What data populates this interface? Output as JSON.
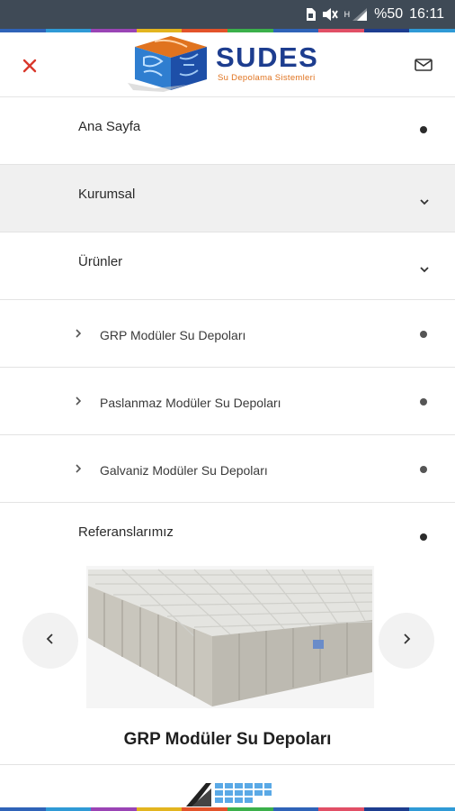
{
  "status_bar": {
    "battery": "%50",
    "time": "16:11",
    "network": "H",
    "icons": [
      "sim-card-icon",
      "mute-icon",
      "signal-icon"
    ]
  },
  "header": {
    "logo_title": "SUDES",
    "logo_subtitle": "Su Depolama Sistemleri",
    "close_icon": "close-icon",
    "mail_icon": "mail-icon"
  },
  "colors": {
    "accent_red": "#d9382c",
    "brand_blue": "#1d3d8f",
    "brand_orange": "#e0731f",
    "status_bar": "#3f4a56",
    "strip": [
      "#2f63b8",
      "#2f9ad6",
      "#9a44b5",
      "#e3b51f",
      "#e3532a",
      "#3bb04b",
      "#2f63b8",
      "#e14f66",
      "#1d3d8f",
      "#2f9ad6"
    ]
  },
  "menu": {
    "items": [
      {
        "label": "Ana Sayfa",
        "indicator": "dot",
        "active": false
      },
      {
        "label": "Kurumsal",
        "indicator": "chevron-down",
        "active": true
      },
      {
        "label": "Ürünler",
        "indicator": "chevron-down",
        "active": false
      },
      {
        "label": "GRP Modüler Su Depoları",
        "indicator": "dot",
        "sub": true
      },
      {
        "label": "Paslanmaz Modüler Su Depoları",
        "indicator": "dot",
        "sub": true
      },
      {
        "label": "Galvaniz Modüler Su Depoları",
        "indicator": "dot",
        "sub": true
      },
      {
        "label": "Referanslarımız",
        "indicator": "dot",
        "active": false
      }
    ]
  },
  "carousel": {
    "caption": "GRP Modüler Su Depoları",
    "prev_icon": "chevron-left-icon",
    "next_icon": "chevron-right-icon"
  }
}
